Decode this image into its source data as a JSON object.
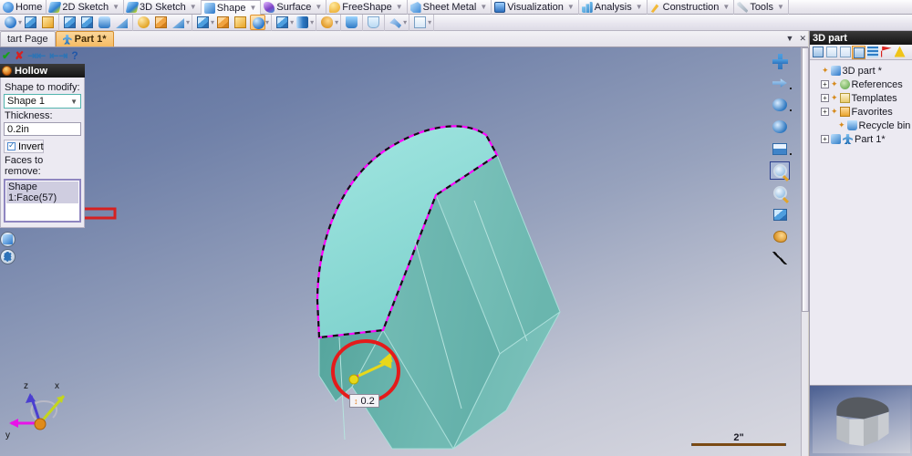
{
  "ribbon": {
    "tabs": [
      {
        "label": "Home",
        "icon": "home-icon",
        "caret": false,
        "active": false
      },
      {
        "label": "2D Sketch",
        "icon": "sketch2d-icon",
        "caret": true,
        "active": false
      },
      {
        "label": "3D Sketch",
        "icon": "sketch3d-icon",
        "caret": true,
        "active": false
      },
      {
        "label": "Shape",
        "icon": "shape-icon",
        "caret": true,
        "active": true
      },
      {
        "label": "Surface",
        "icon": "surface-icon",
        "caret": true,
        "active": false
      },
      {
        "label": "FreeShape",
        "icon": "freeshape-icon",
        "caret": true,
        "active": false
      },
      {
        "label": "Sheet Metal",
        "icon": "sheetmetal-icon",
        "caret": true,
        "active": false
      },
      {
        "label": "Visualization",
        "icon": "visualization-icon",
        "caret": true,
        "active": false
      },
      {
        "label": "Analysis",
        "icon": "analysis-icon",
        "caret": true,
        "active": false
      },
      {
        "label": "Construction",
        "icon": "construction-icon",
        "caret": true,
        "active": false
      },
      {
        "label": "Tools",
        "icon": "tools-icon",
        "caret": true,
        "active": false
      }
    ]
  },
  "toolbar": {
    "groups": [
      {
        "buttons": [
          {
            "name": "extrude-icon",
            "style": "g-ballb",
            "caret": true,
            "selected": false
          },
          {
            "name": "revolve-icon",
            "style": "g-cube",
            "caret": false,
            "selected": false
          },
          {
            "name": "sweep-icon",
            "style": "g-yel",
            "caret": false,
            "selected": false
          }
        ]
      },
      {
        "buttons": [
          {
            "name": "box-icon",
            "style": "g-cube",
            "caret": false,
            "selected": false
          },
          {
            "name": "box-variant-icon",
            "style": "g-cube",
            "caret": false,
            "selected": false
          },
          {
            "name": "loft-icon",
            "style": "g-tube",
            "caret": false,
            "selected": false
          },
          {
            "name": "wedge-icon",
            "style": "g-wedge",
            "caret": false,
            "selected": false
          }
        ]
      },
      {
        "buttons": [
          {
            "name": "sphere-icon",
            "style": "g-ball",
            "caret": false,
            "selected": false
          },
          {
            "name": "prism-icon",
            "style": "g-cube2",
            "caret": false,
            "selected": false
          },
          {
            "name": "ramp-icon",
            "style": "g-wedge",
            "caret": true,
            "selected": false
          }
        ]
      },
      {
        "buttons": [
          {
            "name": "fillet-icon",
            "style": "g-cube",
            "caret": true,
            "selected": false
          },
          {
            "name": "chamfer-icon",
            "style": "g-cube2",
            "caret": false,
            "selected": false
          },
          {
            "name": "draft-icon",
            "style": "g-yel",
            "caret": false,
            "selected": false
          },
          {
            "name": "hollow-icon",
            "style": "g-ballb",
            "caret": true,
            "selected": true
          }
        ]
      },
      {
        "buttons": [
          {
            "name": "shell-icon",
            "style": "g-cube",
            "caret": true,
            "selected": false
          },
          {
            "name": "thread-icon",
            "style": "g-cyl",
            "caret": true,
            "selected": false
          }
        ]
      },
      {
        "buttons": [
          {
            "name": "material-icon",
            "style": "g-palette",
            "caret": true,
            "selected": false
          }
        ]
      },
      {
        "buttons": [
          {
            "name": "boolean-union-icon",
            "style": "g-book",
            "caret": false,
            "selected": false
          }
        ]
      },
      {
        "buttons": [
          {
            "name": "boolean-subtract-icon",
            "style": "g-cup",
            "caret": false,
            "selected": false
          }
        ]
      },
      {
        "buttons": [
          {
            "name": "measure-icon",
            "style": "g-wrench",
            "caret": true,
            "selected": false
          }
        ]
      },
      {
        "buttons": [
          {
            "name": "analysis-tool-icon",
            "style": "g-chart",
            "caret": true,
            "selected": false
          }
        ]
      }
    ]
  },
  "doc_tabs": {
    "items": [
      {
        "label": "tart Page",
        "active": false,
        "icon": false
      },
      {
        "label": "Part 1*",
        "active": true,
        "icon": true
      }
    ],
    "dropdown_icon": "chevron-down-icon",
    "close_icon": "close-icon"
  },
  "panel": {
    "title": "Hollow",
    "title_icon": "hollow-icon",
    "actions": [
      {
        "name": "confirm-button",
        "glyph": "✔",
        "cls": "ok"
      },
      {
        "name": "cancel-button",
        "glyph": "✘",
        "cls": "cancel"
      },
      {
        "name": "previous-step-button",
        "glyph": "⇥⇤",
        "cls": "arrows"
      },
      {
        "name": "next-step-button",
        "glyph": "⇤⇥",
        "cls": "arrows"
      },
      {
        "name": "help-button",
        "glyph": "?",
        "cls": "help"
      }
    ],
    "shape_label": "Shape to modify:",
    "shape_value": "Shape 1",
    "thickness_label": "Thickness:",
    "thickness_value": "0.2in",
    "invert_label": "Invert",
    "invert_checked": true,
    "faces_label": "Faces to remove:",
    "faces_items": [
      "Shape 1:Face(57)"
    ],
    "footer_buttons": [
      {
        "name": "preview-button",
        "icon": "cube-preview-icon"
      },
      {
        "name": "options-button",
        "icon": "gear-icon"
      }
    ]
  },
  "viewport_toolbar": {
    "buttons": [
      {
        "name": "pan-icon",
        "style": "plus",
        "caret": false,
        "active": false
      },
      {
        "name": "rotate-icon",
        "style": "vtrack",
        "caret": true,
        "active": false
      },
      {
        "name": "look-at-icon",
        "style": "vrot",
        "caret": true,
        "active": false
      },
      {
        "name": "fly-icon",
        "style": "vrot",
        "caret": false,
        "active": false
      },
      {
        "name": "view-layout-icon",
        "style": "vwin",
        "caret": true,
        "active": false
      },
      {
        "name": "zoom-area-icon",
        "style": "mag",
        "caret": false,
        "active": true
      },
      {
        "name": "zoom-icon",
        "style": "mag",
        "caret": false,
        "active": false
      },
      {
        "name": "render-mode-icon",
        "style": "vbox",
        "caret": false,
        "active": false
      },
      {
        "name": "appearance-icon",
        "style": "vpal",
        "caret": false,
        "active": false
      },
      {
        "name": "hidden-line-icon",
        "style": "vdash",
        "caret": false,
        "active": false
      }
    ]
  },
  "viewport": {
    "callout_value": "0.2",
    "callout_marker": "↕",
    "scale_label": "2\"",
    "triad": {
      "x_label": "x",
      "y_label": "y",
      "z_label": "z"
    },
    "annotation": {
      "name": "red-circle-highlight",
      "color": "#e41b1b"
    },
    "arrow_annotation": {
      "name": "red-arrow-callout",
      "color": "#d62020"
    },
    "colors": {
      "selected_face": "#8fdcd8",
      "body_face": "#6fb8b0",
      "body_face_dark": "#5aa49d",
      "selection_outline": "#ff00ff",
      "manipulator": "#e8d81a"
    }
  },
  "right_dock": {
    "title": "3D part",
    "toolbar": [
      {
        "name": "select-mode-icon",
        "style": "d-sel",
        "selected": false
      },
      {
        "name": "tree-filter-icon",
        "style": "d-tree",
        "selected": false
      },
      {
        "name": "clear-filter-icon",
        "style": "d-x",
        "selected": false
      },
      {
        "name": "two-level-icon",
        "style": "d-2",
        "selected": true
      },
      {
        "name": "layers-icon",
        "style": "d-wave",
        "selected": false
      },
      {
        "name": "flag-icon",
        "style": "d-flag",
        "selected": false
      },
      {
        "name": "warning-icon",
        "style": "d-warn",
        "selected": false
      }
    ],
    "tree": [
      {
        "label": "3D part *",
        "indent": 0,
        "expander": "",
        "bullet": true,
        "icon": "ni-part"
      },
      {
        "label": "References",
        "indent": 1,
        "expander": "+",
        "bullet": true,
        "icon": "ni-ref"
      },
      {
        "label": "Templates",
        "indent": 1,
        "expander": "+",
        "bullet": true,
        "icon": "ni-tmpl"
      },
      {
        "label": "Favorites",
        "indent": 1,
        "expander": "+",
        "bullet": true,
        "icon": "ni-fav"
      },
      {
        "label": "Recycle bin",
        "indent": 2,
        "expander": "",
        "bullet": true,
        "icon": "ni-bin"
      },
      {
        "label": "Part 1*",
        "indent": 1,
        "expander": "+",
        "bullet": false,
        "icon": "ni-p1a"
      }
    ],
    "preview_name": "part-preview-thumbnail"
  }
}
